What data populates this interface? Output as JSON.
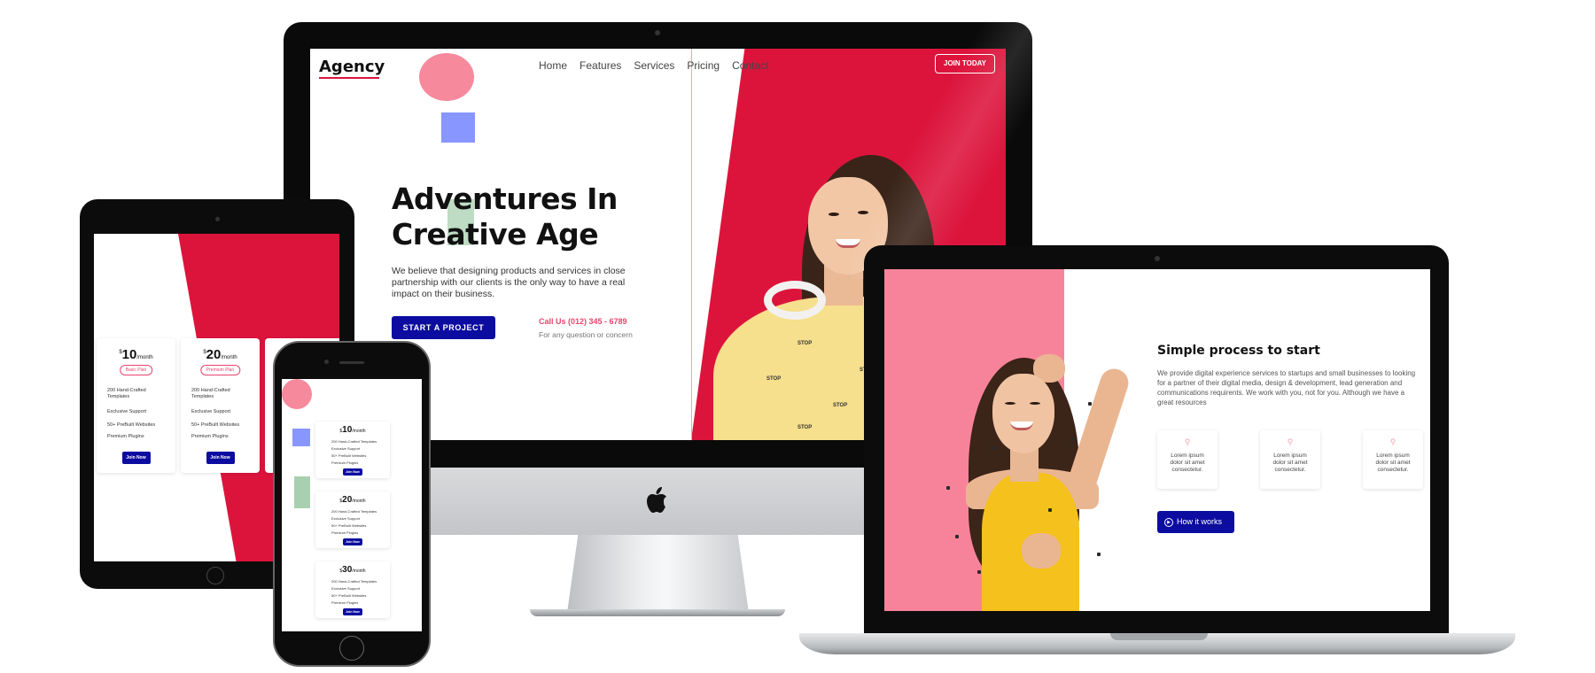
{
  "desktop": {
    "logo": "Agency",
    "nav": [
      "Home",
      "Features",
      "Services",
      "Pricing",
      "Contact"
    ],
    "join_button": "JOIN TODAY",
    "hero_title_line1": "Adventures In",
    "hero_title_line2": "Creative Age",
    "hero_text": "We believe that designing products and services in close partnership with our clients is the only way to have a real impact on their business.",
    "cta_button": "START A PROJECT",
    "call_text": "Call Us (012) 345 - 6789",
    "call_sub": "For any question or concern",
    "shirt_text": "STOP"
  },
  "tablet": {
    "cards": [
      {
        "currency": "$",
        "price": "10",
        "period": "/month",
        "plan": "Basic Plan",
        "features": [
          "200 Hand-Crafted Templates",
          "Exclusive Support",
          "50+ PreBuilt Websites",
          "Premium Plugins"
        ],
        "button": "Join Now"
      },
      {
        "currency": "$",
        "price": "20",
        "period": "/month",
        "plan": "Premium Plan",
        "features": [
          "200 Hand-Crafted Templates",
          "Exclusive Support",
          "50+ PreBuilt Websites",
          "Premium Plugins"
        ],
        "button": "Join Now"
      }
    ]
  },
  "phone": {
    "cards": [
      {
        "currency": "$",
        "price": "10",
        "period": "/month",
        "features": [
          "200 Hand-Crafted Templates",
          "Exclusive Support",
          "50+ PreBuilt Websites",
          "Premium Plugins"
        ],
        "button": "Join Now"
      },
      {
        "currency": "$",
        "price": "20",
        "period": "/month",
        "features": [
          "200 Hand-Crafted Templates",
          "Exclusive Support",
          "50+ PreBuilt Websites",
          "Premium Plugins"
        ],
        "button": "Join Now"
      },
      {
        "currency": "$",
        "price": "30",
        "period": "/month",
        "features": [
          "200 Hand-Crafted Templates",
          "Exclusive Support",
          "50+ PreBuilt Websites",
          "Premium Plugins"
        ],
        "button": "Join Now"
      }
    ]
  },
  "laptop": {
    "title": "Simple process to start",
    "text": "We provide digital experience services to startups and small businesses to looking for a partner of their digital media, design & development, lead generation and communications requirents. We work with you, not for you. Although we have a great resources",
    "cards": [
      "Lorem ipsum dolor sit amet consectetur.",
      "Lorem ipsum dolor sit amet consectetur.",
      "Lorem ipsum dolor sit amet consectetur."
    ],
    "button": "How it works"
  },
  "colors": {
    "accent_red": "#dc143c",
    "pink": "#f7839a",
    "navy_button": "#0c0ca0",
    "periwinkle": "#8896ff",
    "sage": "#a8d0b0"
  },
  "icons": [
    "apple-logo-icon",
    "search-icon",
    "play-icon"
  ]
}
